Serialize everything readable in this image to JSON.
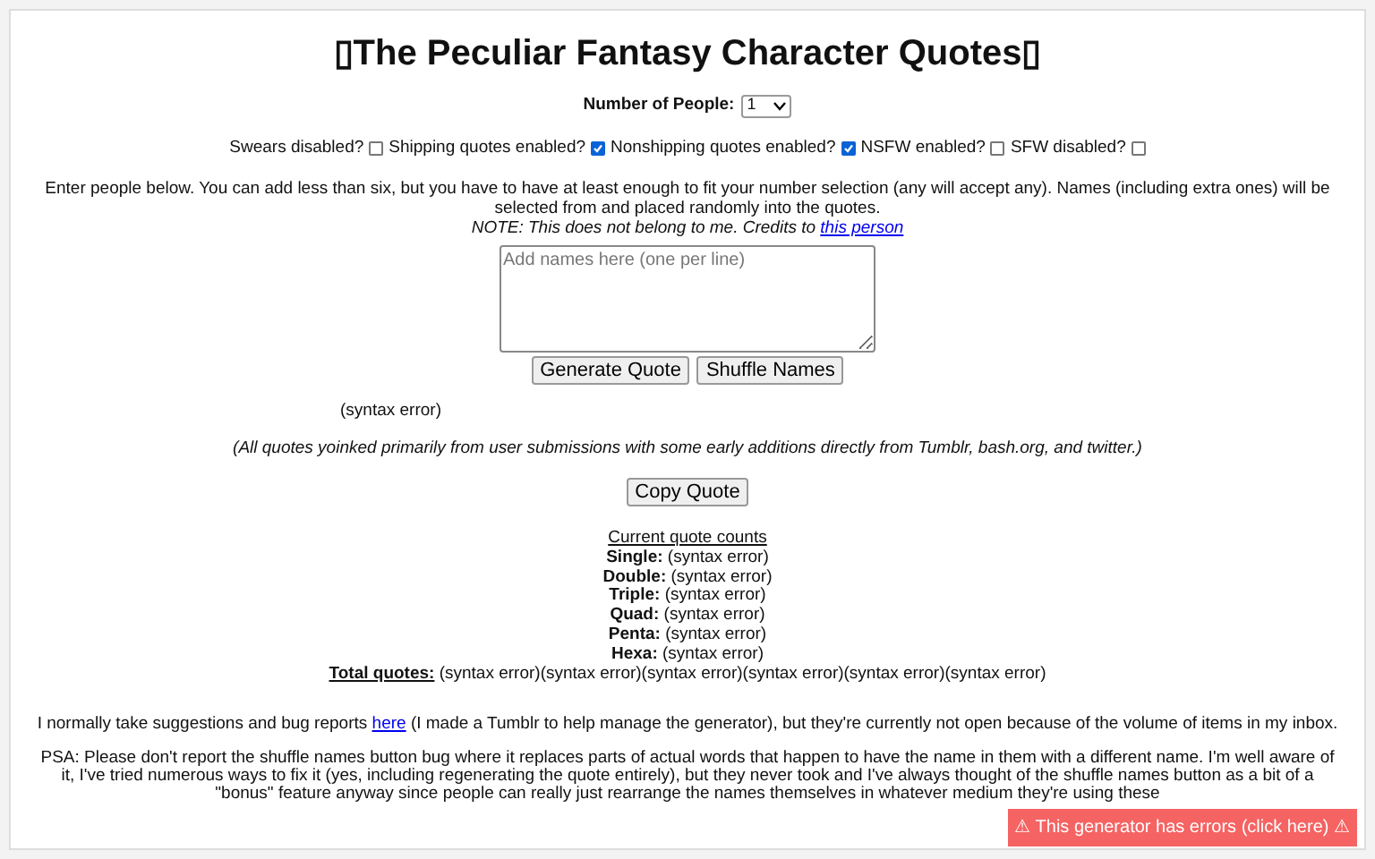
{
  "title": "▯The Peculiar Fantasy Character Quotes▯",
  "people": {
    "label": "Number of People:",
    "value": "1"
  },
  "options": [
    {
      "label": "Swears disabled?",
      "checked": false
    },
    {
      "label": "Shipping quotes enabled?",
      "checked": true
    },
    {
      "label": "Nonshipping quotes enabled?",
      "checked": true
    },
    {
      "label": "NSFW enabled?",
      "checked": false
    },
    {
      "label": "SFW disabled?",
      "checked": false
    }
  ],
  "instructions": "Enter people below. You can add less than six, but you have to have at least enough to fit your number selection (any will accept any). Names (including extra ones) will be selected from and placed randomly into the quotes.",
  "note": {
    "text": "NOTE: This does not belong to me. Credits to",
    "link": "this person"
  },
  "names_field": {
    "placeholder": "Add names here (one per line)"
  },
  "buttons": [
    "Generate Quote",
    "Shuffle Names"
  ],
  "output": "(syntax error)",
  "source_note": "(All quotes yoinked primarily from user submissions with some early additions directly from Tumblr, bash.org, and twitter.)",
  "copy_button": "Copy Quote",
  "counts": {
    "heading": "Current quote counts",
    "rows": [
      {
        "label": "Single:",
        "value": "(syntax error)"
      },
      {
        "label": "Double:",
        "value": "(syntax error)"
      },
      {
        "label": "Triple:",
        "value": "(syntax error)"
      },
      {
        "label": "Quad:",
        "value": "(syntax error)"
      },
      {
        "label": "Penta:",
        "value": "(syntax error)"
      },
      {
        "label": "Hexa:",
        "value": "(syntax error)"
      }
    ],
    "total_label": "Total quotes:",
    "total_value": "(syntax error)(syntax error)(syntax error)(syntax error)(syntax error)(syntax error)"
  },
  "suggestions": {
    "before": "I normally take suggestions and bug reports",
    "link": "here",
    "after": "(I made a Tumblr to help manage the generator), but they're currently not open because of the volume of items in my inbox."
  },
  "psa": "PSA: Please don't report the shuffle names button bug where it replaces parts of actual words that happen to have the name in them with a different name. I'm well aware of it, I've tried numerous ways to fix it (yes, including regenerating the quote entirely), but they never took and I've always thought of the shuffle names button as a bit of a \"bonus\" feature anyway since people can really just rearrange the names themselves in whatever medium they're using these",
  "error_badge": "⚠ This generator has errors (click here) ⚠"
}
